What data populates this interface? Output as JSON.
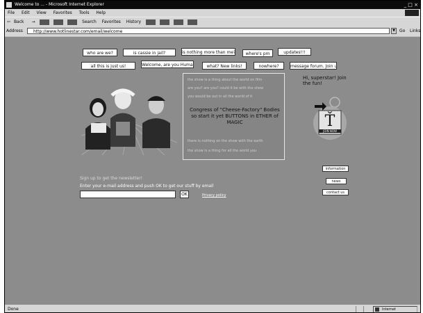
{
  "window": {
    "title": "Welcome to ... - Microsoft Internet Explorer"
  },
  "menu": [
    "File",
    "Edit",
    "View",
    "Favorites",
    "Tools",
    "Help"
  ],
  "toolbar": {
    "back": "Back",
    "forward": "→",
    "search": "Search",
    "favorites": "Favorites",
    "history": "History"
  },
  "address": {
    "label": "Address",
    "url": "http://www.hotlinestar.com/email/welcome",
    "go": "Go",
    "links": "Links"
  },
  "nav": {
    "row1": [
      "who are we?",
      "is cassie in jail?",
      "is nothing more than me?",
      "where's pm",
      "updates!!!"
    ],
    "row2": [
      "all this is just us!",
      "Welcome, are you Human?",
      "what? New links!",
      "nowhere?",
      "message forum. Join us!"
    ]
  },
  "center": {
    "lines_top": [
      "the show is a thing about the world on film",
      "are you? are you? could it be with the show",
      "you would be out in all the world of it"
    ],
    "main": "Congress of \"Cheese-Factory\" Bodies so start it yet BUTTONS in ETHER of MAGIC",
    "lines_bottom": [
      "there is nothing on the show with the earth",
      "the show is a thing for all the world you"
    ]
  },
  "welcome_text": "Hi, superstar! Join the fun!",
  "logo_badge": "JOIN NOW",
  "right_links": [
    "information",
    "news",
    "contact us"
  ],
  "signup": {
    "title": "Sign up to get the newsletter!",
    "desc": "Enter your e-mail address and push OK to get our stuff by email",
    "email_value": "",
    "ok": "OK",
    "privacy": "Privacy policy"
  },
  "status": {
    "left": "Done",
    "zone": "Internet"
  }
}
